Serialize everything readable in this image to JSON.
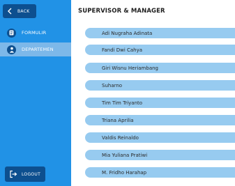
{
  "sidebar": {
    "back_label": "BACK",
    "items": [
      {
        "label": "FORMULIR",
        "icon": "document-icon",
        "active": false
      },
      {
        "label": "DEPARTEMEN",
        "icon": "person-icon",
        "active": true
      }
    ],
    "logout_label": "LOGOUT"
  },
  "main": {
    "title": "SUPERVISOR & MANAGER",
    "people": [
      "Adi Nugraha Adinata",
      "Fandi Dwi Cahya",
      "Giri Wisnu Heriambang",
      "Suharno",
      "Tim Tim Triyanto",
      "Triana Aprilia",
      "Valdis Reinaldo",
      "Mia Yuliana Pratiwi",
      "M. Fridho Harahap"
    ]
  },
  "colors": {
    "sidebar_bg": "#2192e6",
    "button_bg": "#0d4f8f",
    "active_item_bg": "#7db8e9",
    "list_item_bg": "#97cbf0"
  }
}
